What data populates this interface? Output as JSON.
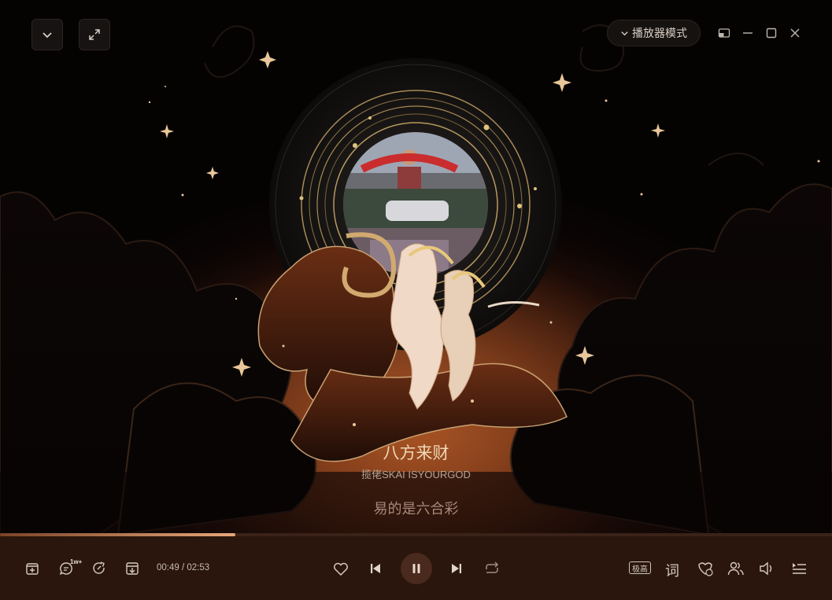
{
  "window": {
    "mode_button_label": "播放器模式"
  },
  "song": {
    "title": "八方来财",
    "artist": "揽佬SKAI ISYOURGOD",
    "current_lyric": "易的是六合彩"
  },
  "playback": {
    "current_time": "00:49",
    "separator": " / ",
    "total_time": "02:53",
    "progress_fraction": 0.283,
    "is_playing": true
  },
  "toolbar": {
    "comment_count_badge": "1w+",
    "quality_label": "极高",
    "lyrics_label": "词"
  },
  "album_art": {
    "banner_text": "SKAI ISYOURGOD"
  },
  "colors": {
    "accent": "#e8a87a",
    "background": "#2a160c",
    "title": "#f0d9b8"
  },
  "icons": {
    "collapse": "chevron-down-icon",
    "fullscreen": "expand-icon",
    "mini_mode": "mini-window-icon",
    "minimize": "minimize-icon",
    "maximize": "maximize-icon",
    "close": "close-icon",
    "add": "add-to-playlist-icon",
    "comment": "comment-icon",
    "share": "share-icon",
    "download": "download-icon",
    "favorite": "heart-icon",
    "prev": "previous-icon",
    "pause": "pause-icon",
    "next": "next-icon",
    "loop": "loop-icon",
    "effect": "sound-effect-icon",
    "listen_together": "listen-together-icon",
    "volume": "volume-icon",
    "playlist": "playlist-icon"
  }
}
